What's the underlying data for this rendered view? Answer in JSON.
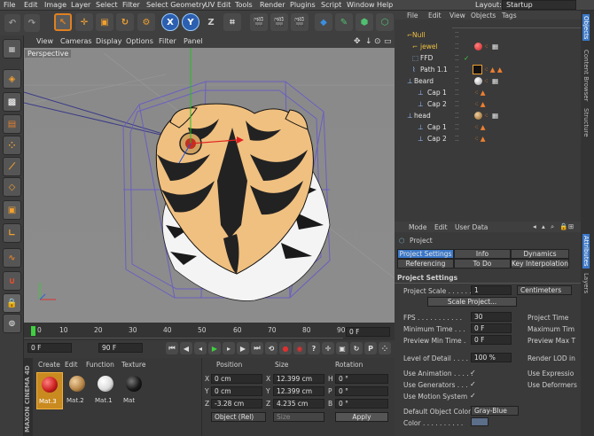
{
  "menu": [
    "File",
    "Edit",
    "Image",
    "Layer",
    "Select",
    "Filter",
    "Select Geometry",
    "UV Edit",
    "Tools",
    "Render",
    "Plugins",
    "Script",
    "Window",
    "Help"
  ],
  "layout": {
    "label": "Layout:",
    "value": "Startup"
  },
  "axis_buttons": [
    "X",
    "Y",
    "Z"
  ],
  "viewport": {
    "menu": [
      "View",
      "Cameras",
      "Display",
      "Options",
      "Filter",
      "Panel"
    ],
    "label": "Perspective"
  },
  "timeline": {
    "ticks": [
      "0",
      "10",
      "20",
      "30",
      "40",
      "50",
      "60",
      "70",
      "80",
      "90"
    ],
    "frame_field": "0 F"
  },
  "transport": {
    "start": "0 F",
    "end": "90 F"
  },
  "materials": {
    "menu": [
      "Create",
      "Edit",
      "Function",
      "Texture"
    ],
    "items": [
      {
        "name": "Mat.3",
        "color": "#cc2222"
      },
      {
        "name": "Mat.2",
        "color": "#b8874a"
      },
      {
        "name": "Mat.1",
        "color": "#dcdcdc"
      },
      {
        "name": "Mat",
        "color": "#1a1a1a"
      }
    ],
    "brand": "MAXON CINEMA 4D"
  },
  "coords": {
    "headers": [
      "Position",
      "Size",
      "Rotation"
    ],
    "rows": [
      {
        "axis": "X",
        "pos": "0 cm",
        "size_axis": "X",
        "size": "12.399 cm",
        "rot_axis": "H",
        "rot": "0 °"
      },
      {
        "axis": "Y",
        "pos": "0 cm",
        "size_axis": "Y",
        "size": "12.399 cm",
        "rot_axis": "P",
        "rot": "0 °"
      },
      {
        "axis": "Z",
        "pos": "-3.28 cm",
        "size_axis": "Z",
        "size": "4.235 cm",
        "rot_axis": "B",
        "rot": "0 °"
      }
    ],
    "mode": "Object (Rel)",
    "size_mode": "Size",
    "apply": "Apply"
  },
  "objects": {
    "menu": [
      "File",
      "Edit",
      "View",
      "Objects",
      "Tags"
    ],
    "items": [
      {
        "name": "Null",
        "indent": 0,
        "color": "#f0c040"
      },
      {
        "name": "jewel",
        "indent": 1,
        "color": "#f0c040"
      },
      {
        "name": "FFD",
        "indent": 1,
        "color": "#9ac0ff"
      },
      {
        "name": "Path 1.1",
        "indent": 1,
        "color": "#e6e6e6"
      },
      {
        "name": "Beard",
        "indent": 1,
        "color": "#e6e6e6"
      },
      {
        "name": "Cap 1",
        "indent": 2,
        "color": "#e6e6e6"
      },
      {
        "name": "Cap 2",
        "indent": 2,
        "color": "#e6e6e6"
      },
      {
        "name": "head",
        "indent": 1,
        "color": "#e6e6e6"
      },
      {
        "name": "Cap 1",
        "indent": 2,
        "color": "#e6e6e6"
      },
      {
        "name": "Cap 2",
        "indent": 2,
        "color": "#e6e6e6"
      }
    ]
  },
  "attributes": {
    "menu": [
      "Mode",
      "Edit",
      "User Data"
    ],
    "title": "Project",
    "tabs_row1": [
      "Project Settings",
      "Info",
      "Dynamics"
    ],
    "tabs_row2": [
      "Referencing",
      "To Do",
      "Key Interpolation"
    ],
    "section": "Project Settings",
    "project_scale_label": "Project Scale . . . . . .",
    "project_scale_value": "1",
    "project_scale_unit": "Centimeters",
    "scale_button": "Scale Project...",
    "fps_label": "FPS . . . . . . . . . . .",
    "fps": "30",
    "project_time": "Project Time",
    "min_time_label": "Minimum Time . . .",
    "min_time": "0 F",
    "max_time": "Maximum Tim",
    "preview_min_label": "Preview Min Time .",
    "preview_min": "0 F",
    "preview_max": "Preview Max T",
    "lod_label": "Level of Detail . . . .",
    "lod": "100 %",
    "render_lod": "Render LOD in",
    "checks": [
      {
        "label": "Use Animation . . . . .",
        "right": "Use Expressio"
      },
      {
        "label": "Use Generators . . .",
        "right": "Use Deformers"
      },
      {
        "label": "Use Motion System",
        "right": ""
      }
    ],
    "default_color_label": "Default Object Color",
    "default_color": "Gray-Blue",
    "color_label": "Color . . . . . . . . . ."
  },
  "sidetabs": {
    "top": [
      "Objects",
      "Content Browser",
      "Structure"
    ],
    "bottom": [
      "Attributes",
      "Layers"
    ]
  }
}
